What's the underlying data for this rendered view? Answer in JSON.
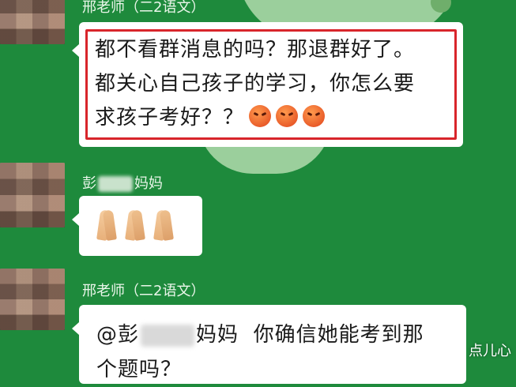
{
  "messages": [
    {
      "sender": "邢老师（二2语文）",
      "lines": [
        "都不看群消息的吗？那退群好了。",
        "都关心自己孩子的学习，你怎么要",
        "求孩子考好？？"
      ],
      "emojis": [
        "angry-face-icon",
        "angry-face-icon",
        "angry-face-icon"
      ]
    },
    {
      "sender_prefix": "彭",
      "sender_suffix": "妈妈",
      "emojis": [
        "folded-hands-icon",
        "folded-hands-icon",
        "folded-hands-icon"
      ]
    },
    {
      "sender": "邢老师（二2语文）",
      "mention_prefix": "@彭",
      "mention_suffix": "妈妈",
      "line1_rest": "你确信她能考到那",
      "line2": "个题吗？"
    }
  ],
  "watermark": "点儿心",
  "colors": {
    "chat_bg": "#1e8a3c",
    "highlight_border": "#d8252b"
  }
}
